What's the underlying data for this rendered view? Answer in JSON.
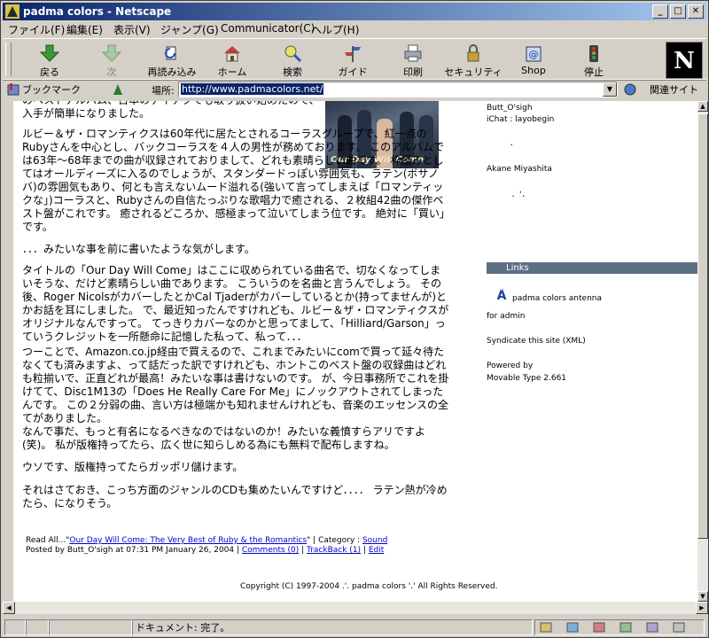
{
  "window": {
    "title": "padma colors - Netscape"
  },
  "menu": [
    "ファイル(F)",
    "編集(E)",
    "表示(V)",
    "ジャンプ(G)",
    "Communicator(C)",
    "ヘルプ(H)"
  ],
  "toolbar": {
    "back": "戻る",
    "forward": "次",
    "reload": "再読み込み",
    "home": "ホーム",
    "search": "検索",
    "guide": "ガイド",
    "print": "印刷",
    "security": "セキュリティ",
    "shop": "Shop",
    "stop": "停止"
  },
  "location": {
    "bookmarks": "ブックマーク",
    "label": "場所:",
    "url": "http://www.padmacolors.net/",
    "related": "関連サイト"
  },
  "article": {
    "p0": "のベストアルバム、日本のテイチクでも取り扱い始めたので、入手が簡単になりました。",
    "p1": "ルビー＆ザ・ロマンティクスは60年代に居たとされるコーラスグループで、紅一点のRubyさんを中心とし、バックコーラスを４人の男性が務めております。 このアルバムでは63年〜68年までの曲が収録されておりまして、どれも素晴らしい曲です。 枠組みとしてはオールディーズに入るのでしょうが、スタンダードっぽい雰囲気も、ラテン(ボサノバ)の雰囲気もあり、何とも言えないムード溢れる(強いて言ってしまえば「ロマンティックな」)コーラスと、Rubyさんの自信たっぷりな歌唱力で癒される、２枚組42曲の傑作ベスト盤がこれです。 癒されるどころか、感極まって泣いてしまう位です。 絶対に「買い」です。",
    "p2": "．．．みたいな事を前に書いたような気がします。",
    "p3": "タイトルの「Our Day Will Come」はここに収められている曲名で、切なくなってしまいそうな、だけど素晴らしい曲であります。 こういうのを名曲と言うんでしょう。 その後、Roger NicolsがカバーしたとかCal Tjaderがカバーしているとか(持ってませんが)とかお話を耳にしました。 で、最近知ったんですけれども、ルビー＆ザ・ロマンティクスがオリジナルなんですって。 てっきりカバーなのかと思ってまして、「Hilliard/Garson」っていうクレジットを一所懸命に記憶した私って、私って．．．",
    "p4": "つーことで、Amazon.co.jp経由で買えるので、これまでみたいにcomで買って延々待たなくても済みますよ、って話だった訳ですけれども、ホントこのベスト盤の収録曲はどれも粒揃いで、正直どれが最高！みたいな事は書けないのです。 が、今日事務所でこれを掛けてて、Disc1M13の「Does He Really Care For Me」にノックアウトされてしまったんです。 この２分弱の曲、言い方は極端かも知れませんけれども、音楽のエッセンスの全てがありました。",
    "p5": "なんで事だ、もっと有名になるべきなのではないのか！みたいな義憤すらアリですよ(笑)。 私が版権持ってたら、広く世に知らしめる為にも無料で配布しますね。",
    "p6": "ウソです、版権持ってたらガッポリ儲けます。",
    "p7": "それはさておき、こっち方面のジャンルのCDも集めたいんですけど．．．． ラテン熱が冷めたら、になりそう。",
    "album_caption": "Our Day Will Come"
  },
  "footer": {
    "read_all": "Read All...\"",
    "read_all_link": "Our Day Will Come: The Very Best of Ruby & the Romantics",
    "cat_prefix": "\" | Category : ",
    "category": "Sound",
    "posted": "Posted by Butt_O'sigh at 07:31 PM January 26, 2004 | ",
    "comments": "Comments (0)",
    "sep1": " | ",
    "trackback": "TrackBack (1)",
    "sep2": " | ",
    "edit": "Edit"
  },
  "sidebar": {
    "user1": "Butt_O'sigh",
    "ichat": "iChat : layobegin",
    "dot1": "．",
    "user2": "Akane Miyashita",
    "dot2": "．'．",
    "links_header": "Links",
    "antenna": "padma colors antenna",
    "admin": "for admin",
    "syndicate": "Syndicate this site (XML)",
    "powered": "Powered by",
    "mt": "Movable Type 2.661"
  },
  "copyright": "Copyright (C)  1997-2004  .'. padma colors '.'   All Rights Reserved.",
  "status": {
    "text": "ドキュメント: 完了。"
  }
}
